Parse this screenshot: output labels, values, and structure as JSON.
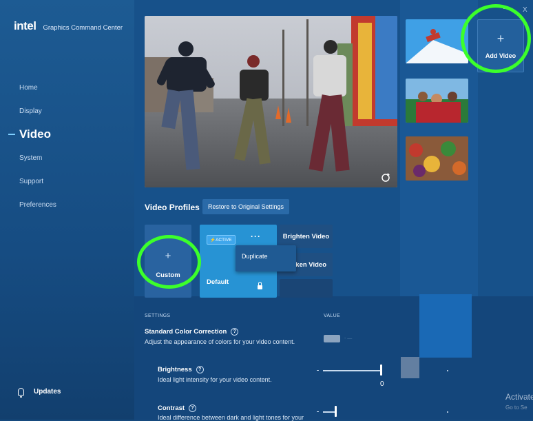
{
  "app": {
    "brand": "intel",
    "name": "Graphics Command Center"
  },
  "window": {
    "close_glyph": "X"
  },
  "sidebar": {
    "items": [
      {
        "label": "Home"
      },
      {
        "label": "Display"
      },
      {
        "label": "Video"
      },
      {
        "label": "System"
      },
      {
        "label": "Support"
      },
      {
        "label": "Preferences"
      }
    ],
    "active": "Video",
    "updates_label": "Updates",
    "updates_icon": "bell-icon"
  },
  "thumbnails": {
    "items": [
      {
        "subject": "snowboarder"
      },
      {
        "subject": "group-of-people"
      },
      {
        "subject": "fruit-market"
      }
    ],
    "add_label": "Add Video",
    "add_icon": "plus-icon"
  },
  "video_profiles": {
    "title": "Video Profiles",
    "restore_label": "Restore to Original Settings",
    "custom_label": "Custom",
    "custom_icon": "plus-icon",
    "default_label": "Default",
    "active_badge": "⚡ACTIVE",
    "more_icon": "ellipsis-icon",
    "brighten_label": "Brighten Video",
    "darken_label_visible": "ken Video",
    "menu": {
      "duplicate_label": "Duplicate"
    }
  },
  "settings": {
    "header": "SETTINGS",
    "value_header": "VALUE",
    "items": [
      {
        "title": "Standard Color Correction",
        "desc": "Adjust the appearance of colors for your video content.",
        "control": "toggle"
      },
      {
        "title": "Brightness",
        "desc": "Ideal light intensity for your video content.",
        "value": "0",
        "position": 1.0
      },
      {
        "title": "Contrast",
        "desc": "Ideal difference between dark and light tones for your",
        "position": 0.55
      }
    ]
  },
  "watermark": {
    "line1": "Activate",
    "line2": "Go to Se"
  },
  "colors": {
    "accent": "#2793d4",
    "sidebar": "#1d5b93",
    "highlight_ring": "#3cff2b"
  }
}
